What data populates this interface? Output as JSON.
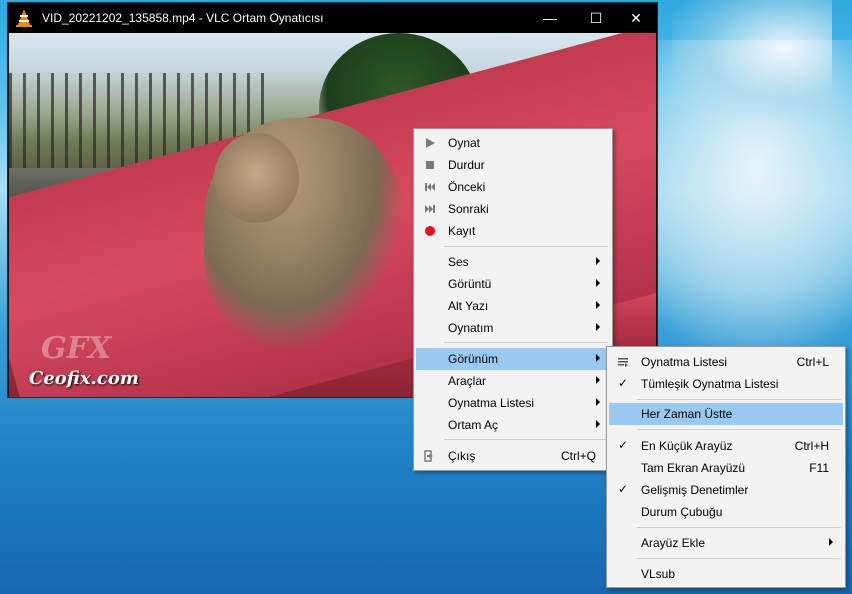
{
  "window": {
    "title": "VID_20221202_135858.mp4 - VLC Ortam Oynatıcısı",
    "controls": {
      "minimize": "—",
      "maximize": "☐",
      "close": "✕"
    },
    "watermark": "Ceofix.com",
    "watermark_logo": "GFX"
  },
  "main_menu": {
    "items": [
      {
        "label": "Oynat",
        "icon": "play-icon"
      },
      {
        "label": "Durdur",
        "icon": "stop-icon"
      },
      {
        "label": "Önceki",
        "icon": "previous-icon"
      },
      {
        "label": "Sonraki",
        "icon": "next-icon"
      },
      {
        "label": "Kayıt",
        "icon": "record-icon"
      },
      {
        "label": "Ses"
      },
      {
        "label": "Görüntü"
      },
      {
        "label": "Alt Yazı"
      },
      {
        "label": "Oynatım"
      },
      {
        "label": "Görünüm"
      },
      {
        "label": "Araçlar"
      },
      {
        "label": "Oynatma Listesi"
      },
      {
        "label": "Ortam Aç"
      },
      {
        "label": "Çıkış",
        "shortcut": "Ctrl+Q",
        "icon": "exit-icon"
      }
    ]
  },
  "view_submenu": {
    "items": [
      {
        "label": "Oynatma Listesi",
        "shortcut": "Ctrl+L",
        "icon": "playlist-icon"
      },
      {
        "label": "Tümleşik Oynatma Listesi",
        "checked": true
      },
      {
        "label": "Her Zaman Üstte"
      },
      {
        "label": "En Küçük Arayüz",
        "shortcut": "Ctrl+H",
        "checked": true
      },
      {
        "label": "Tam Ekran Arayüzü",
        "shortcut": "F11"
      },
      {
        "label": "Gelişmiş Denetimler",
        "checked": true
      },
      {
        "label": "Durum Çubuğu"
      },
      {
        "label": "Arayüz Ekle"
      },
      {
        "label": "VLsub"
      }
    ]
  },
  "colors": {
    "highlight": "#99c9ef",
    "record": "#e81123",
    "vlc_orange": "#f08a00"
  }
}
